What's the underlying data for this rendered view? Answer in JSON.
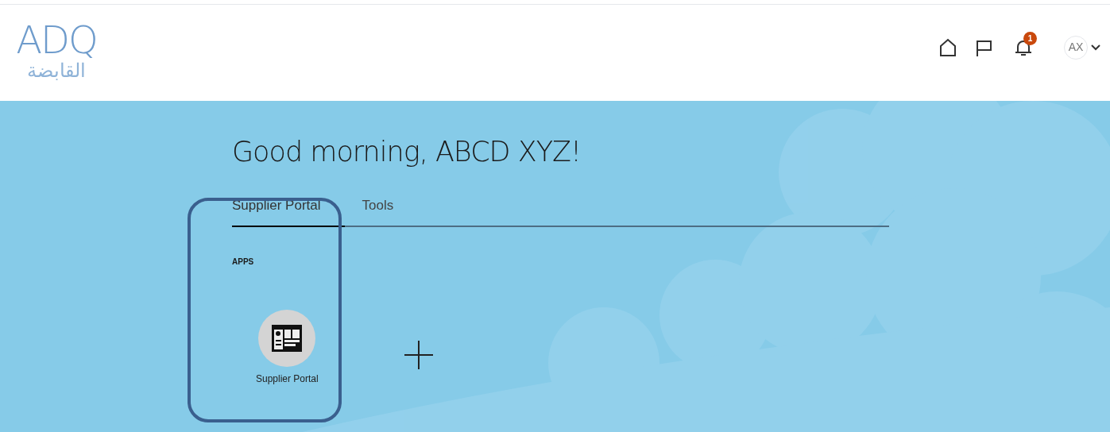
{
  "logo": {
    "mark": "ADQ",
    "subtitle": "القابضة"
  },
  "header": {
    "notifications_badge": "1",
    "avatar": "AX"
  },
  "greeting": "Good morning, ABCD XYZ!",
  "tabs": [
    {
      "label": "Supplier Portal",
      "selected": true
    },
    {
      "label": "Tools",
      "selected": false
    }
  ],
  "section_label": "APPS",
  "apps": [
    {
      "label": "Supplier Portal"
    }
  ]
}
